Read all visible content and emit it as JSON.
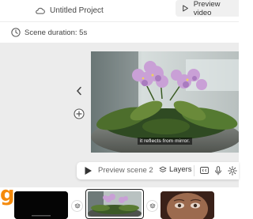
{
  "header": {
    "project_title": "Untitled Project",
    "preview_video_label": "Preview video"
  },
  "scene_info": {
    "duration_label": "Scene duration: 5s"
  },
  "scene": {
    "subtitle": "it reflects from mirror."
  },
  "controls": {
    "preview_scene_label": "Preview scene 2",
    "layers_label": "Layers"
  },
  "filmstrip": {
    "brand_letter": "g",
    "selected_scene": 2
  },
  "icons": {
    "project": "cloud-icon",
    "preview": "play-outline-icon",
    "duration": "clock-icon",
    "nav": "chevron-left-icon",
    "add": "plus-circle-icon",
    "play": "play-icon",
    "layers": "layers-icon",
    "captions": "cc-icon",
    "mic": "microphone-icon",
    "settings": "gear-icon",
    "transition": "transition-icon"
  },
  "colors": {
    "brand": "#f58a0b",
    "canvas": "#ececec",
    "button_bg": "#f0f0f0"
  }
}
